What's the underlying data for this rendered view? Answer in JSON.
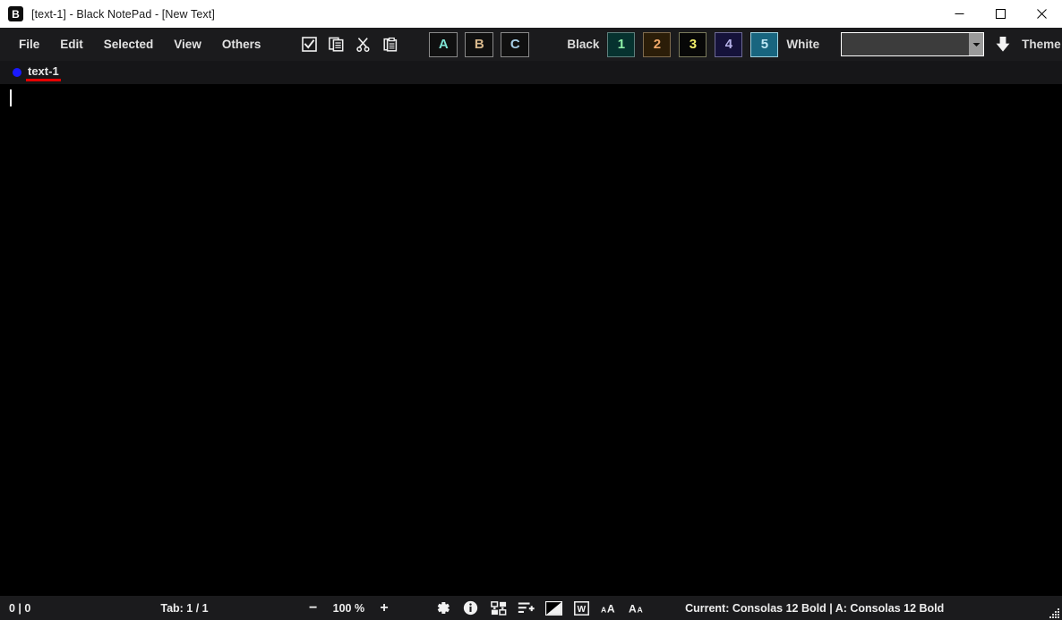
{
  "window": {
    "title": "[text-1] - Black NotePad - [New Text]",
    "logo_letter": "B",
    "controls": {
      "minimize": "minimize-icon",
      "maximize": "maximize-icon",
      "close": "close-icon"
    }
  },
  "menubar": {
    "items": [
      {
        "label": "File"
      },
      {
        "label": "Edit"
      },
      {
        "label": "Selected"
      },
      {
        "label": "View"
      },
      {
        "label": "Others"
      }
    ],
    "tool_icons": [
      {
        "name": "select-all-checkbox-icon"
      },
      {
        "name": "copy-icon"
      },
      {
        "name": "cut-scissors-icon"
      },
      {
        "name": "paste-clipboard-icon"
      }
    ],
    "abc_buttons": [
      {
        "label": "A",
        "color": "#7fe3d4"
      },
      {
        "label": "B",
        "color": "#d8b88c"
      },
      {
        "label": "C",
        "color": "#a8cfe8"
      }
    ],
    "palette": {
      "left_label": "Black",
      "right_label": "White",
      "buttons": [
        {
          "label": "1",
          "bg": "#06322f",
          "fg": "#8ff0a8",
          "border": "#5e7f7c",
          "selected": false
        },
        {
          "label": "2",
          "bg": "#2b1d08",
          "fg": "#f0a86a",
          "border": "#7f6b4e",
          "selected": false
        },
        {
          "label": "3",
          "bg": "#070707",
          "fg": "#f2ef6a",
          "border": "#7a7a5c",
          "selected": false
        },
        {
          "label": "4",
          "bg": "#15123a",
          "fg": "#b6b2e8",
          "border": "#6e6b94",
          "selected": false
        },
        {
          "label": "5",
          "bg": "#18657f",
          "fg": "#bfe8f5",
          "border": "#9fd2e0",
          "selected": true
        }
      ]
    },
    "theme": {
      "combo_value": "",
      "combo_placeholder": "",
      "download_icon": "download-arrow-icon",
      "label": "Theme"
    }
  },
  "tabs": [
    {
      "label": "text-1",
      "dot_color": "#1a1aff",
      "active": true,
      "underline_color": "#e60000"
    }
  ],
  "editor": {
    "content": "",
    "background": "#000000",
    "caret_visible": true
  },
  "statusbar": {
    "cursor_position": "0 | 0",
    "tab_counter": "Tab: 1 / 1",
    "zoom_out_label": "−",
    "zoom_value": "100 %",
    "zoom_in_label": "+",
    "icons": [
      {
        "name": "settings-gear-icon"
      },
      {
        "name": "info-icon"
      },
      {
        "name": "swap-replace-icon"
      },
      {
        "name": "add-to-list-icon"
      },
      {
        "name": "invert-contrast-icon"
      },
      {
        "name": "word-wrap-icon"
      },
      {
        "name": "increase-font-size-icon"
      },
      {
        "name": "decrease-font-size-icon"
      }
    ],
    "font_info": "Current: Consolas 12 Bold | A: Consolas 12 Bold",
    "resize_grip": "resize-grip-icon"
  },
  "colors": {
    "titlebar_bg": "#ffffff",
    "chrome_bg": "#1b1b1d",
    "tabbar_bg": "#161618",
    "editor_bg": "#000000",
    "text_primary": "#ededed"
  }
}
